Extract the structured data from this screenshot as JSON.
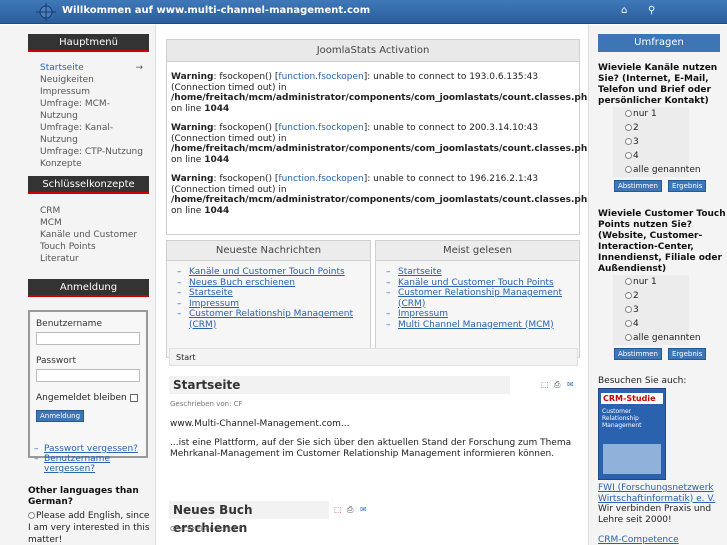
{
  "header": {
    "title": "Willkommen auf www.multi-channel-management.com",
    "icon_home": "home-icon",
    "icon_search": "search-icon"
  },
  "left": {
    "main_menu": {
      "title": "Hauptmenü",
      "items": [
        "Startseite",
        "Neuigkeiten",
        "Impressum",
        "Umfrage: MCM-Nutzung",
        "Umfrage: Kanal-Nutzung",
        "Umfrage: CTP-Nutzung",
        "Konzepte"
      ],
      "active_arrow": "→"
    },
    "key_concepts": {
      "title": "Schlüsselkonzepte",
      "items": [
        "CRM",
        "MCM",
        "Kanäle und Customer Touch Points",
        "Literatur"
      ]
    },
    "login": {
      "title": "Anmeldung",
      "username_label": "Benutzername",
      "password_label": "Passwort",
      "remember_label": "Angemeldet bleiben",
      "submit": "Anmeldung",
      "forgot_password": "Passwort vergessen?",
      "forgot_username": "Benutzername vergessen?"
    },
    "languages": {
      "question": "Other languages than German?",
      "option": "Please add English, since I am very interested in this matter!"
    }
  },
  "main": {
    "activation": {
      "title": "JoomlaStats Activation",
      "warnings": [
        {
          "label": "Warning",
          "pre": ": fsockopen() [",
          "link": "function.fsockopen",
          "post": "]: unable to connect to 193.0.6.135:43 (Connection timed out) in ",
          "path": "/home/freitach/mcm/administrator/components/com_joomlastats/count.classes.php",
          "online": " on line ",
          "line": "1044"
        },
        {
          "label": "Warning",
          "pre": ": fsockopen() [",
          "link": "function.fsockopen",
          "post": "]: unable to connect to 200.3.14.10:43 (Connection timed out) in ",
          "path": "/home/freitach/mcm/administrator/components/com_joomlastats/count.classes.php",
          "online": " on line ",
          "line": "1044"
        },
        {
          "label": "Warning",
          "pre": ": fsockopen() [",
          "link": "function.fsockopen",
          "post": "]: unable to connect to 196.216.2.1:43 (Connection timed out) in ",
          "path": "/home/freitach/mcm/administrator/components/com_joomlastats/count.classes.php",
          "online": " on line ",
          "line": "1044"
        }
      ]
    },
    "latest_news": {
      "title": "Neueste Nachrichten",
      "items": [
        "Kanäle und Customer Touch Points",
        "Neues Buch erschienen",
        "Startseite",
        "Impressum",
        "Customer Relationship Management (CRM)"
      ]
    },
    "most_read": {
      "title": "Meist gelesen",
      "items": [
        "Startseite",
        "Kanäle und Customer Touch Points",
        "Customer Relationship Management (CRM)",
        "Impressum",
        "Multi Channel Management (MCM)"
      ]
    },
    "breadcrumb": "Start",
    "article1": {
      "title": "Startseite",
      "author": "Geschrieben von: CF",
      "para1": "www.Multi-Channel-Management.com...",
      "para2": "...ist eine Plattform, auf der Sie sich über den aktuellen Stand der Forschung zum Thema Mehrkanal-Management im Customer Relationship Management informieren können."
    },
    "article2": {
      "title": "Neues Buch erschienen",
      "author": "Geschrieben von: CF"
    }
  },
  "right": {
    "polls_title": "Umfragen",
    "poll1": {
      "question": "Wieviele Kanäle nutzen Sie? (Internet, E-Mail, Telefon und Brief oder persönlicher Kontakt)",
      "options": [
        "nur 1",
        "2",
        "3",
        "4",
        "alle genannten"
      ],
      "vote": "Abstimmen",
      "results": "Ergebnis"
    },
    "poll2": {
      "question": "Wieviele Customer Touch Points nutzen Sie? (Website, Customer-Interaction-Center, Innendienst, Filiale oder Außendienst)",
      "options": [
        "nur 1",
        "2",
        "3",
        "4",
        "alle genannten"
      ],
      "vote": "Abstimmen",
      "results": "Ergebnis"
    },
    "visit_label": "Besuchen Sie auch:",
    "book_cover": {
      "title": "CRM-Studie",
      "subtitle": "Customer Relationship Management"
    },
    "fwi_link": "FWI (Forschungsnetzwerk Wirtschaftinformatik) e. V.",
    "fwi_text": "Wir verbinden Praxis und Lehre seit 2000!",
    "crm_link": "CRM-Competence"
  }
}
